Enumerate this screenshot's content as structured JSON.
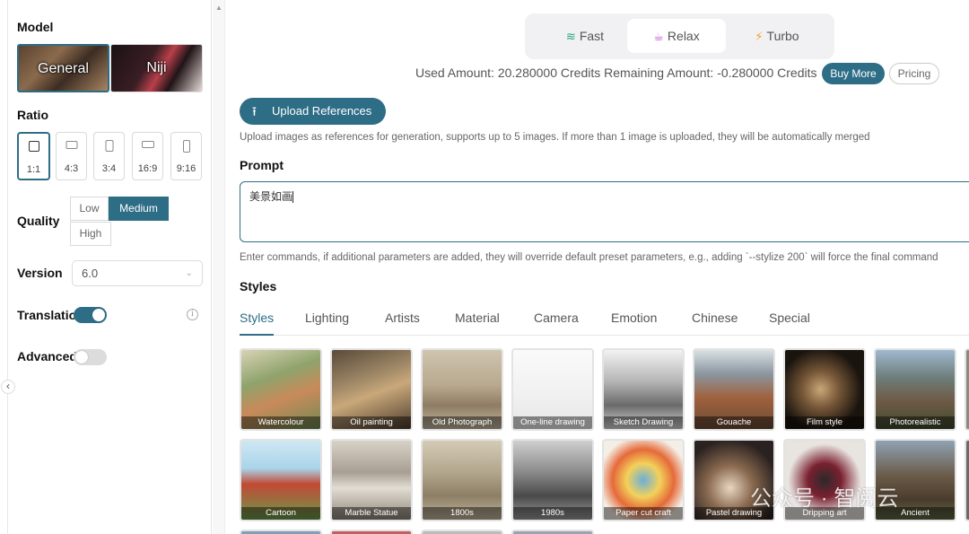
{
  "sidebar": {
    "model_label": "Model",
    "models": [
      {
        "label": "General",
        "selected": true
      },
      {
        "label": "Niji",
        "selected": false
      }
    ],
    "ratio_label": "Ratio",
    "ratios": [
      {
        "label": "1:1",
        "selected": true
      },
      {
        "label": "4:3",
        "selected": false
      },
      {
        "label": "3:4",
        "selected": false
      },
      {
        "label": "16:9",
        "selected": false
      },
      {
        "label": "9:16",
        "selected": false
      }
    ],
    "quality_label": "Quality",
    "quality_options": [
      {
        "label": "Low",
        "selected": false
      },
      {
        "label": "Medium",
        "selected": true
      },
      {
        "label": "High",
        "selected": false
      }
    ],
    "version_label": "Version",
    "version_value": "6.0",
    "translation_label": "Translation",
    "translation_on": true,
    "advanced_label": "Advanced",
    "advanced_on": false
  },
  "modes": [
    {
      "label": "Fast",
      "icon": "wind-icon",
      "icon_glyph": "≋",
      "icon_color": "#2aa57a",
      "selected": false
    },
    {
      "label": "Relax",
      "icon": "coffee-cup-icon",
      "icon_glyph": "☕",
      "icon_color": "#c04fd0",
      "selected": true
    },
    {
      "label": "Turbo",
      "icon": "lightning-icon",
      "icon_glyph": "⚡",
      "icon_color": "#f0a020",
      "selected": false
    }
  ],
  "credits": {
    "text": "Used Amount: 20.280000 Credits Remaining Amount: -0.280000 Credits",
    "buy_more": "Buy More",
    "pricing": "Pricing"
  },
  "upload": {
    "button_label": "Upload References",
    "hint": "Upload images as references for generation, supports up to 5 images. If more than 1 image is uploaded, they will be automatically merged"
  },
  "prompt": {
    "label": "Prompt",
    "value": "美景如画",
    "hint": "Enter commands, if additional parameters are added, they will override default preset parameters, e.g., adding `--stylize 200` will force the final command"
  },
  "styles": {
    "label": "Styles",
    "tabs": [
      "Styles",
      "Lighting",
      "Artists",
      "Material",
      "Camera",
      "Emotion",
      "Chinese",
      "Special"
    ],
    "active_tab": "Styles",
    "row1": [
      "Watercolour",
      "Oil painting",
      "Old Photograph",
      "One-line drawing",
      "Sketch Drawing",
      "Gouache",
      "Film style",
      "Photorealistic"
    ],
    "row2": [
      "Cartoon",
      "Marble Statue",
      "1800s",
      "1980s",
      "Paper cut craft",
      "Pastel drawing",
      "Dripping art",
      "Ancient"
    ]
  },
  "watermark": "公众号 · 智阅云",
  "colors": {
    "accent": "#2e6d86"
  }
}
